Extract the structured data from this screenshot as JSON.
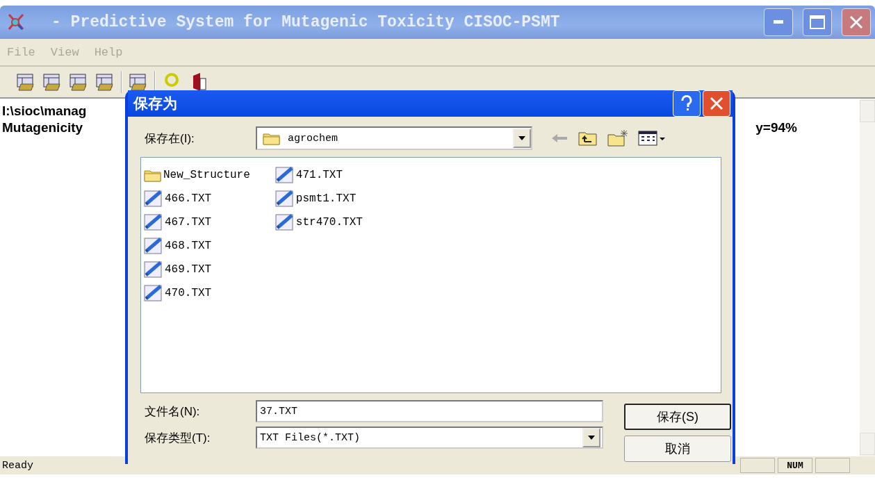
{
  "window": {
    "title": "- Predictive System for Mutagenic Toxicity CISOC-PSMT"
  },
  "menu": [
    {
      "label": "File",
      "disabled": true
    },
    {
      "label": "View",
      "disabled": true
    },
    {
      "label": "Help",
      "disabled": true
    }
  ],
  "document": {
    "lines": [
      {
        "fragments": [
          "I:\\sioc\\manag"
        ]
      },
      {
        "fragments": [
          "Mutagenicity",
          "y=94%"
        ]
      }
    ]
  },
  "status_bar": {
    "text": "Ready",
    "indicators": [
      "NUM"
    ]
  },
  "dialog": {
    "title": "保存为",
    "save_in_label": "保存在(I):",
    "location": "agrochem",
    "files": [
      {
        "name": "New_Structure",
        "kind": "folder"
      },
      {
        "name": "466.TXT",
        "kind": "file"
      },
      {
        "name": "467.TXT",
        "kind": "file"
      },
      {
        "name": "468.TXT",
        "kind": "file"
      },
      {
        "name": "469.TXT",
        "kind": "file"
      },
      {
        "name": "470.TXT",
        "kind": "file"
      },
      {
        "name": "471.TXT",
        "kind": "file"
      },
      {
        "name": "psmt1.TXT",
        "kind": "file"
      },
      {
        "name": "str470.TXT",
        "kind": "file"
      }
    ],
    "file_name_label": "文件名(N):",
    "file_name": "37.TXT",
    "file_type_label": "保存类型(T):",
    "file_type": "TXT Files(*.TXT)",
    "buttons": [
      {
        "label": "保存(S)",
        "default": true
      },
      {
        "label": "取消",
        "default": false
      }
    ]
  }
}
